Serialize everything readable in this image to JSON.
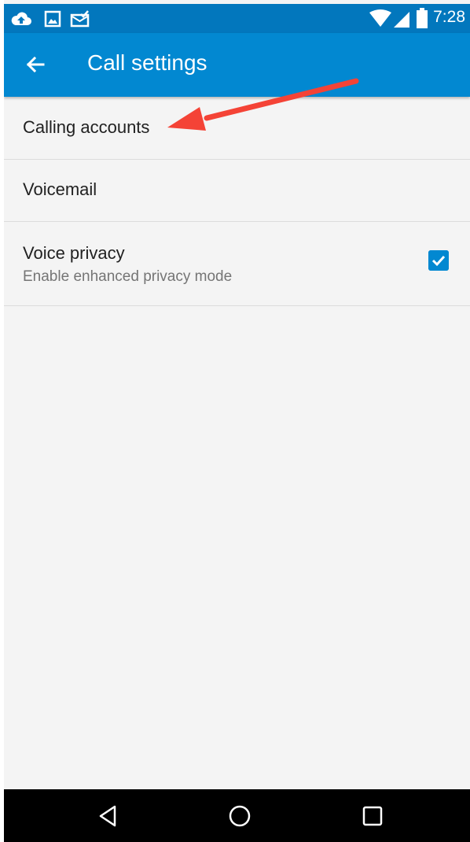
{
  "status_bar": {
    "time": "7:28",
    "left_icons": [
      "cloud-upload-icon",
      "image-icon",
      "mail-check-icon"
    ],
    "right_icons": [
      "wifi-icon",
      "signal-icon",
      "battery-icon"
    ]
  },
  "app_bar": {
    "title": "Call settings",
    "back_icon": "arrow-left-icon",
    "color": "#0288d1",
    "status_color": "#0277bd"
  },
  "preferences": [
    {
      "title": "Calling accounts"
    },
    {
      "title": "Voicemail"
    },
    {
      "title": "Voice privacy",
      "summary": "Enable enhanced privacy mode",
      "checked": true
    }
  ],
  "annotation": {
    "type": "arrow",
    "color": "#f44336",
    "points_to": "Calling accounts"
  },
  "nav_bar": {
    "icons": [
      "back-triangle-icon",
      "home-circle-icon",
      "recents-square-icon"
    ]
  }
}
